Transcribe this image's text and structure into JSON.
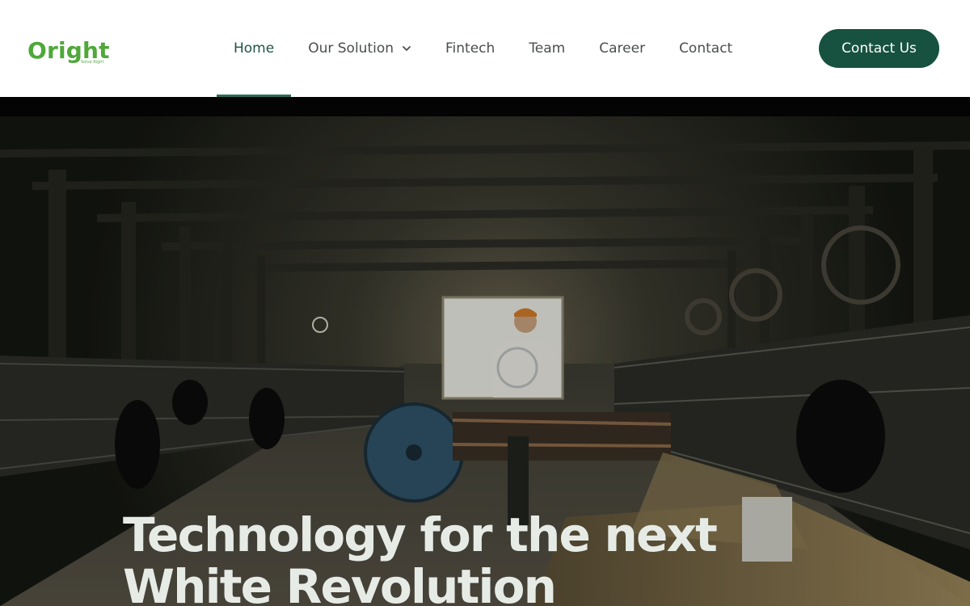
{
  "brand": {
    "name": "Oright",
    "tagline": "Solve Right",
    "primary_color": "#17513f",
    "logo_color": "#4fa83a"
  },
  "nav": {
    "items": [
      {
        "label": "Home",
        "active": true
      },
      {
        "label": "Our Solution",
        "has_dropdown": true
      },
      {
        "label": "Fintech"
      },
      {
        "label": "Team"
      },
      {
        "label": "Career"
      },
      {
        "label": "Contact"
      }
    ]
  },
  "header": {
    "cta_label": "Contact Us"
  },
  "hero": {
    "title_line_1": "Technology for the next",
    "title_line_2": "White Revolution",
    "image_subject": "farmer driving a feed cart through a dairy cow barn"
  }
}
